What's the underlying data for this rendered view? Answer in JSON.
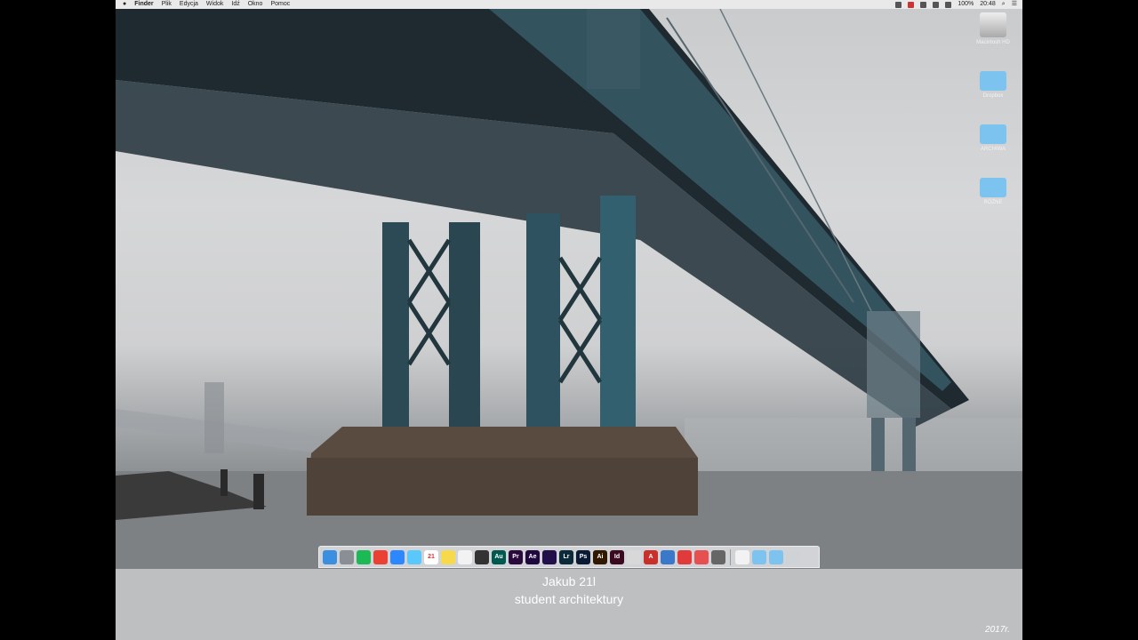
{
  "menubar": {
    "apple": "",
    "items": [
      "Finder",
      "Plik",
      "Edycja",
      "Widok",
      "Idź",
      "Okno",
      "Pomoc"
    ],
    "status": {
      "calendar_day": "21",
      "battery": "100%",
      "clock": "20:48"
    }
  },
  "desktop_icons": [
    {
      "label": "Macintosh HD",
      "icon": "hard-drive-icon"
    },
    {
      "label": "Dropbox",
      "icon": "dropbox-folder-icon"
    },
    {
      "label": "ARCHIWA",
      "icon": "folder-icon"
    },
    {
      "label": "RÓŻNE",
      "icon": "folder-icon"
    }
  ],
  "dock": {
    "apps": [
      {
        "name": "finder-icon",
        "label": "",
        "color": "#3b8fe0"
      },
      {
        "name": "launchpad-icon",
        "label": "",
        "color": "#8a8f95"
      },
      {
        "name": "spotify-icon",
        "label": "",
        "color": "#1db954"
      },
      {
        "name": "chrome-icon",
        "label": "",
        "color": "#e94235"
      },
      {
        "name": "messenger-icon",
        "label": "",
        "color": "#2d88ff"
      },
      {
        "name": "messages-icon",
        "label": "",
        "color": "#5ac8fa"
      },
      {
        "name": "calendar-icon",
        "label": "21",
        "color": "#ffffff"
      },
      {
        "name": "notes-icon",
        "label": "",
        "color": "#f7d94c"
      },
      {
        "name": "textedit-icon",
        "label": "",
        "color": "#f2f2f2"
      },
      {
        "name": "camera-icon",
        "label": "",
        "color": "#333333"
      },
      {
        "name": "audition-icon",
        "label": "Au",
        "color": "#00594f"
      },
      {
        "name": "premiere-icon",
        "label": "Pr",
        "color": "#2a0a3d"
      },
      {
        "name": "aftereffects-icon",
        "label": "Ae",
        "color": "#1f0740"
      },
      {
        "name": "mediaencoder-icon",
        "label": "",
        "color": "#22104a"
      },
      {
        "name": "lightroom-icon",
        "label": "Lr",
        "color": "#0b2a3a"
      },
      {
        "name": "photoshop-icon",
        "label": "Ps",
        "color": "#0a1b33"
      },
      {
        "name": "illustrator-icon",
        "label": "Ai",
        "color": "#331800"
      },
      {
        "name": "indesign-icon",
        "label": "Id",
        "color": "#3b0a1e"
      },
      {
        "name": "document-icon",
        "label": "",
        "color": "#d8d8d8"
      },
      {
        "name": "autocad-icon",
        "label": "A",
        "color": "#c9302c"
      },
      {
        "name": "archicad-icon",
        "label": "",
        "color": "#3a78c9"
      },
      {
        "name": "app-red-icon",
        "label": "",
        "color": "#e03a3a"
      },
      {
        "name": "app-red2-icon",
        "label": "",
        "color": "#e65050"
      },
      {
        "name": "utility-icon",
        "label": "",
        "color": "#666666"
      },
      {
        "name": "home-folder-icon",
        "label": "",
        "color": "#f2f2f2"
      },
      {
        "name": "applications-folder-icon",
        "label": "",
        "color": "#7cc3f0"
      },
      {
        "name": "downloads-folder-icon",
        "label": "",
        "color": "#7cc3f0"
      },
      {
        "name": "trash-icon",
        "label": "",
        "color": "#cfd3d6"
      }
    ]
  },
  "caption": {
    "line1": "Jakub 21l",
    "line2": "student architektury",
    "year": "2017r."
  },
  "colors": {
    "caption_bg": "#bdbfc1",
    "bridge": "#2c4a55"
  }
}
